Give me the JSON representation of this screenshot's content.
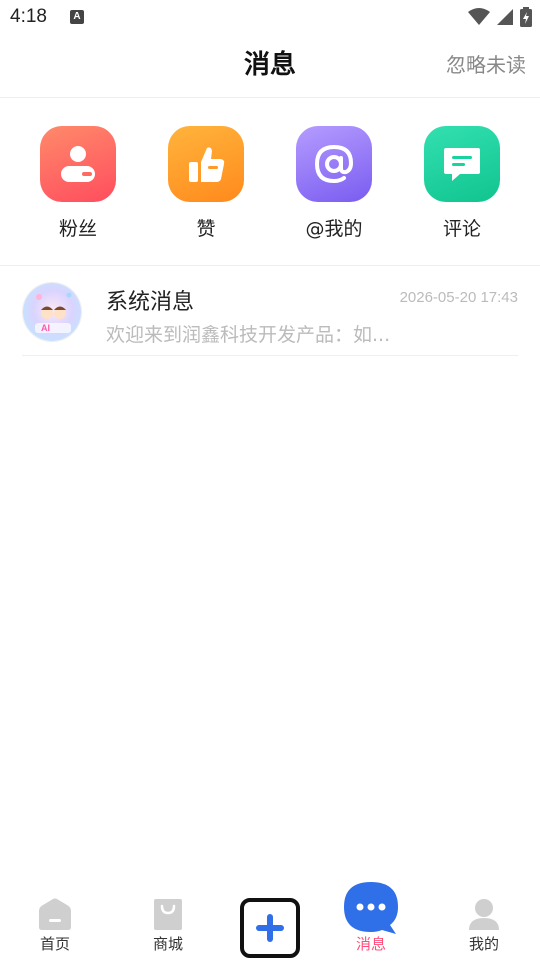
{
  "status_bar": {
    "time": "4:18",
    "notification_glyph": "A"
  },
  "header": {
    "title": "消息",
    "action": "忽略未读"
  },
  "categories": [
    {
      "label": "粉丝",
      "icon": "person-icon",
      "color": "#ff5a5f"
    },
    {
      "label": "赞",
      "icon": "thumbs-up-icon",
      "color": "#ff9a26"
    },
    {
      "label": "@我的",
      "icon": "at-icon",
      "color": "#8b6cf4"
    },
    {
      "label": "评论",
      "icon": "comment-icon",
      "color": "#18d39d"
    }
  ],
  "messages": [
    {
      "title": "系统消息",
      "time": "2026-05-20 17:43",
      "preview": "欢迎来到润鑫科技开发产品：如...",
      "avatar_text": "AI"
    }
  ],
  "tabbar": {
    "items": [
      {
        "label": "首页",
        "icon": "home-icon"
      },
      {
        "label": "商城",
        "icon": "shopping-bag-icon"
      },
      {
        "label": "",
        "icon": "add-icon"
      },
      {
        "label": "消息",
        "icon": "message-icon",
        "active": true
      },
      {
        "label": "我的",
        "icon": "profile-icon"
      }
    ],
    "active_color": "#ff4d7a",
    "message_color": "#2f6fe8"
  }
}
